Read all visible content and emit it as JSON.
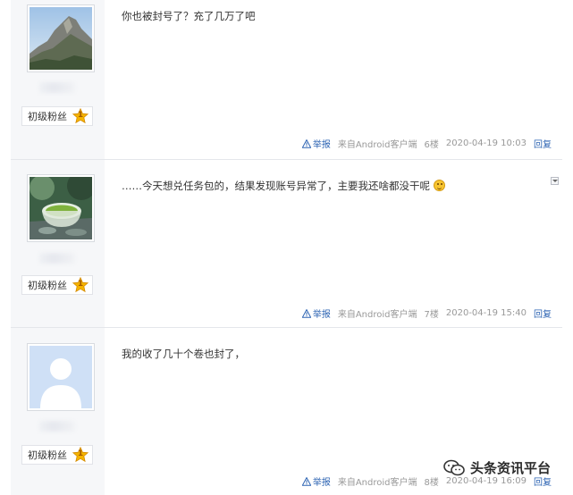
{
  "posts": [
    {
      "user_badge": "初级粉丝",
      "badge_level": "1",
      "content": "你也被封号了？充了几万了吧",
      "report_label": "举报",
      "source": "来自Android客户端",
      "floor": "6楼",
      "time": "2020-04-19 10:03",
      "reply_label": "回复"
    },
    {
      "user_badge": "初级粉丝",
      "badge_level": "1",
      "content": "……今天想兑任务包的，结果发现账号异常了，主要我还啥都没干呢",
      "report_label": "举报",
      "source": "来自Android客户端",
      "floor": "7楼",
      "time": "2020-04-19 15:40",
      "reply_label": "回复"
    },
    {
      "user_badge": "初级粉丝",
      "badge_level": "1",
      "content": "我的收了几十个卷也封了，",
      "report_label": "举报",
      "source": "来自Android客户端",
      "floor": "8楼",
      "time": "2020-04-19 16:09",
      "reply_label": "回复"
    }
  ],
  "watermark": "头条资讯平台",
  "colors": {
    "link": "#2d64b3",
    "sidebar_bg": "#f6f7f9",
    "badge_star": "#f5b400"
  }
}
